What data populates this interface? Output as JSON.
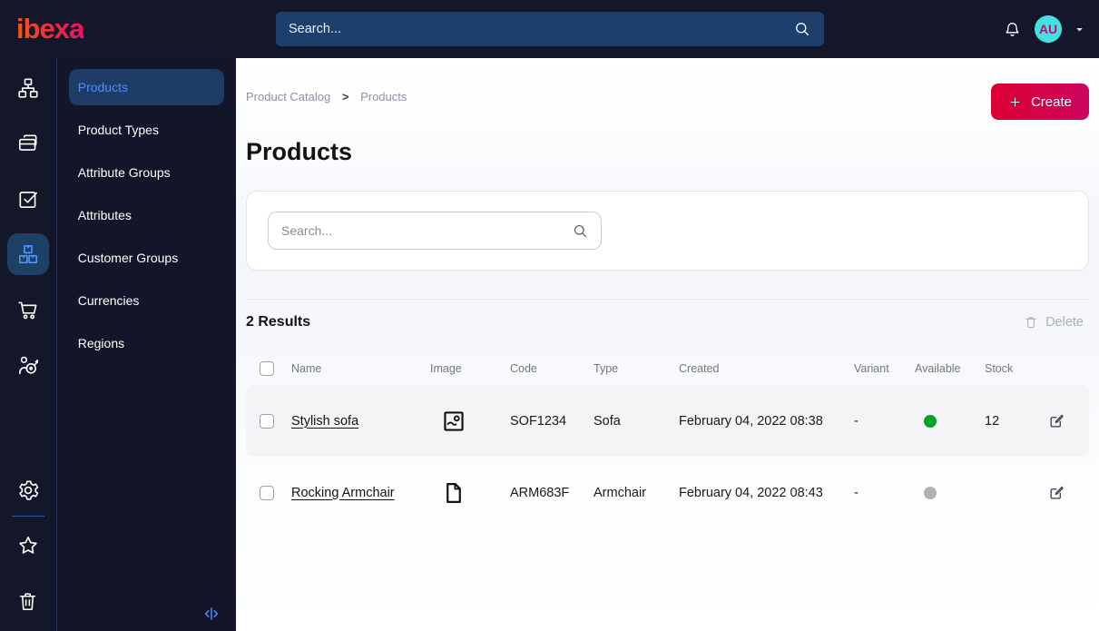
{
  "topbar": {
    "logo_text": "ibexa",
    "search_placeholder": "Search...",
    "avatar_initials": "AU"
  },
  "icon_rail": {
    "items": [
      {
        "icon": "content-tree-icon",
        "active": false
      },
      {
        "icon": "pages-icon",
        "active": false
      },
      {
        "icon": "tasks-icon",
        "active": false
      },
      {
        "icon": "product-catalog-icon",
        "active": true
      },
      {
        "icon": "commerce-cart-icon",
        "active": false
      },
      {
        "icon": "segmentation-icon",
        "active": false
      }
    ],
    "footer_items": [
      {
        "icon": "settings-gear-icon"
      },
      {
        "icon": "bookmarks-star-icon"
      },
      {
        "icon": "trash-icon"
      }
    ]
  },
  "sidebar": {
    "items": [
      {
        "label": "Products",
        "active": true
      },
      {
        "label": "Product Types",
        "active": false
      },
      {
        "label": "Attribute Groups",
        "active": false
      },
      {
        "label": "Attributes",
        "active": false
      },
      {
        "label": "Customer Groups",
        "active": false
      },
      {
        "label": "Currencies",
        "active": false
      },
      {
        "label": "Regions",
        "active": false
      }
    ]
  },
  "breadcrumb": {
    "items": [
      "Product Catalog",
      "Products"
    ],
    "separator": ">"
  },
  "page": {
    "title": "Products"
  },
  "actions": {
    "create_label": "Create"
  },
  "filter": {
    "search_placeholder": "Search..."
  },
  "results": {
    "count": "2 Results",
    "delete_label": "Delete"
  },
  "table": {
    "columns": [
      "Name",
      "Image",
      "Code",
      "Type",
      "Created",
      "Variant",
      "Available",
      "Stock"
    ],
    "rows": [
      {
        "name": "Stylish sofa",
        "media": "image-icon",
        "code": "SOF1234",
        "type": "Sofa",
        "created": "February 04, 2022 08:38",
        "variant": "-",
        "available": "available",
        "stock": "12"
      },
      {
        "name": "Rocking Armchair",
        "media": "file-icon",
        "code": "ARM683F",
        "type": "Armchair",
        "created": "February 04, 2022 08:43",
        "variant": "-",
        "available": "unavailable",
        "stock": ""
      }
    ]
  },
  "colors": {
    "topbar_bg": "#141729",
    "brand_gradient_start": "#ff5314",
    "brand_gradient_end": "#ed1164",
    "create_gradient_start": "#dc0032",
    "create_gradient_end": "#cb0460",
    "active_blue": "#4e8dfd",
    "active_item_bg": "#1e3c66",
    "available_green": "#00a22e",
    "unavailable_gray": "#b2b2b2",
    "avatar_bg": "#40e2e2",
    "avatar_text": "#d6006e"
  }
}
